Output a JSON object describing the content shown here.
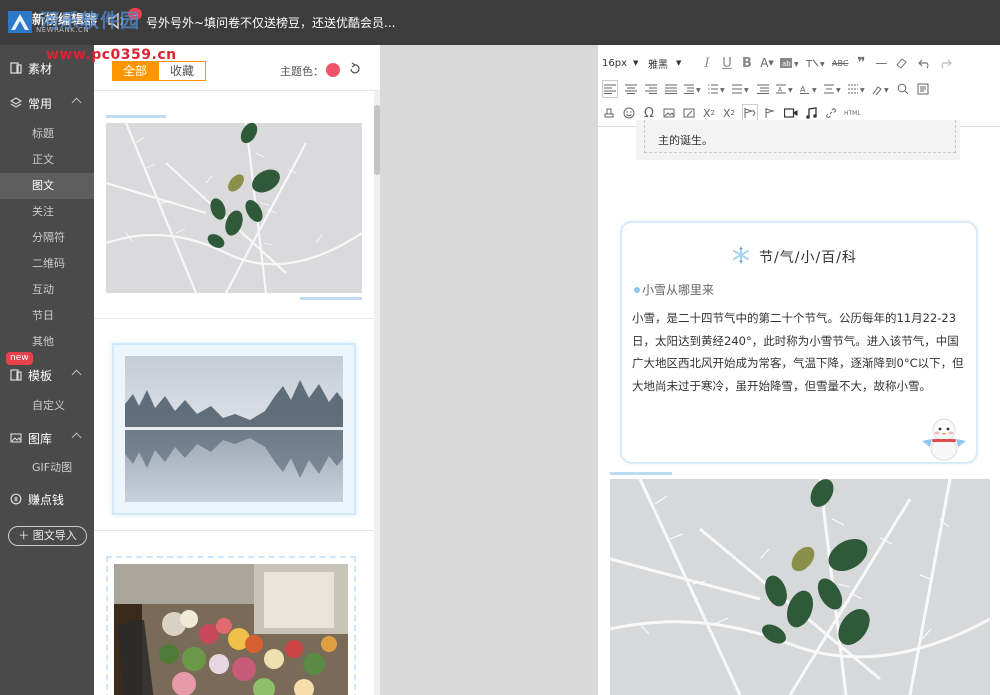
{
  "topbar": {
    "app_name": "新榜编辑器",
    "app_sub": "NEWRANK.CN",
    "notice_badge": "...",
    "notice": "号外号外~填问卷不仅送榜豆，还送优酷会员..."
  },
  "watermark": {
    "text": "河乐软件园",
    "url": "www.pc0359.cn"
  },
  "sidebar": {
    "material": "素材",
    "common": "常用",
    "items": [
      "标题",
      "正文",
      "图文",
      "关注",
      "分隔符",
      "二维码",
      "互动",
      "节日",
      "其他"
    ],
    "active_item": "图文",
    "new_badge": "new",
    "template": "模板",
    "custom": "自定义",
    "gallery": "图库",
    "gif": "GIF动图",
    "earn": "赚点钱",
    "import_button": "＋ 图文导入"
  },
  "panel": {
    "tab_all": "全部",
    "tab_fav": "收藏",
    "theme_label": "主题色：",
    "theme_color": "#ee5566"
  },
  "toolbar": {
    "font_size": "16px",
    "font_family": "雅黑",
    "html_label": "HTML"
  },
  "editor": {
    "prev_text": "主的诞生。",
    "card_title": "节/气/小/百/科",
    "card_sub": "小雪从哪里来",
    "card_body": "小雪，是二十四节气中的第二十个节气。公历每年的11月22-23日，太阳达到黄经240°，此时称为小雪节气。进入该节气，中国广大地区西北风开始成为常客，气温下降，逐渐降到0°C以下，但大地尚未过于寒冷，虽开始降雪，但雪量不大，故称小雪。"
  },
  "colors": {
    "accent": "#ff9600",
    "sidebar_bg": "#4a4a4a",
    "topbar_bg": "#3c3c3c",
    "card_border": "#d7ebfa"
  }
}
